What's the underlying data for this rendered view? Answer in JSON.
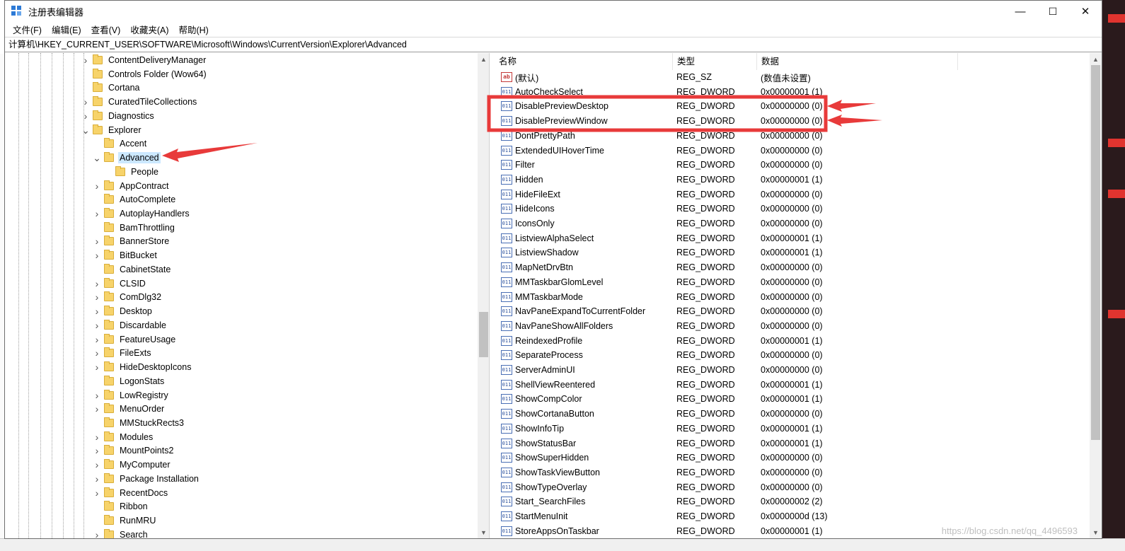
{
  "window": {
    "title": "注册表编辑器",
    "controls": {
      "minimize": "—",
      "maximize": "☐",
      "close": "✕"
    }
  },
  "menu": [
    "文件(F)",
    "编辑(E)",
    "查看(V)",
    "收藏夹(A)",
    "帮助(H)"
  ],
  "address": "计算机\\HKEY_CURRENT_USER\\SOFTWARE\\Microsoft\\Windows\\CurrentVersion\\Explorer\\Advanced",
  "tree": {
    "items": [
      {
        "label": "ContentDeliveryManager",
        "level": 1,
        "expander": "collapsed"
      },
      {
        "label": "Controls Folder (Wow64)",
        "level": 1,
        "expander": "none"
      },
      {
        "label": "Cortana",
        "level": 1,
        "expander": "none"
      },
      {
        "label": "CuratedTileCollections",
        "level": 1,
        "expander": "collapsed"
      },
      {
        "label": "Diagnostics",
        "level": 1,
        "expander": "collapsed"
      },
      {
        "label": "Explorer",
        "level": 1,
        "expander": "expanded"
      },
      {
        "label": "Accent",
        "level": 2,
        "expander": "none"
      },
      {
        "label": "Advanced",
        "level": 2,
        "expander": "expanded",
        "selected": true
      },
      {
        "label": "People",
        "level": 3,
        "expander": "none"
      },
      {
        "label": "AppContract",
        "level": 2,
        "expander": "collapsed"
      },
      {
        "label": "AutoComplete",
        "level": 2,
        "expander": "none"
      },
      {
        "label": "AutoplayHandlers",
        "level": 2,
        "expander": "collapsed"
      },
      {
        "label": "BamThrottling",
        "level": 2,
        "expander": "none"
      },
      {
        "label": "BannerStore",
        "level": 2,
        "expander": "collapsed"
      },
      {
        "label": "BitBucket",
        "level": 2,
        "expander": "collapsed"
      },
      {
        "label": "CabinetState",
        "level": 2,
        "expander": "none"
      },
      {
        "label": "CLSID",
        "level": 2,
        "expander": "collapsed"
      },
      {
        "label": "ComDlg32",
        "level": 2,
        "expander": "collapsed"
      },
      {
        "label": "Desktop",
        "level": 2,
        "expander": "collapsed"
      },
      {
        "label": "Discardable",
        "level": 2,
        "expander": "collapsed"
      },
      {
        "label": "FeatureUsage",
        "level": 2,
        "expander": "collapsed"
      },
      {
        "label": "FileExts",
        "level": 2,
        "expander": "collapsed"
      },
      {
        "label": "HideDesktopIcons",
        "level": 2,
        "expander": "collapsed"
      },
      {
        "label": "LogonStats",
        "level": 2,
        "expander": "none"
      },
      {
        "label": "LowRegistry",
        "level": 2,
        "expander": "collapsed"
      },
      {
        "label": "MenuOrder",
        "level": 2,
        "expander": "collapsed"
      },
      {
        "label": "MMStuckRects3",
        "level": 2,
        "expander": "none"
      },
      {
        "label": "Modules",
        "level": 2,
        "expander": "collapsed"
      },
      {
        "label": "MountPoints2",
        "level": 2,
        "expander": "collapsed"
      },
      {
        "label": "MyComputer",
        "level": 2,
        "expander": "collapsed"
      },
      {
        "label": "Package Installation",
        "level": 2,
        "expander": "collapsed"
      },
      {
        "label": "RecentDocs",
        "level": 2,
        "expander": "collapsed"
      },
      {
        "label": "Ribbon",
        "level": 2,
        "expander": "none"
      },
      {
        "label": "RunMRU",
        "level": 2,
        "expander": "none"
      },
      {
        "label": "Search",
        "level": 2,
        "expander": "collapsed"
      }
    ]
  },
  "list": {
    "columns": [
      "名称",
      "类型",
      "数据"
    ],
    "rows": [
      {
        "name": "(默认)",
        "type": "REG_SZ",
        "data": "(数值未设置)",
        "icon": "string"
      },
      {
        "name": "AutoCheckSelect",
        "type": "REG_DWORD",
        "data": "0x00000001 (1)",
        "icon": "binary"
      },
      {
        "name": "DisablePreviewDesktop",
        "type": "REG_DWORD",
        "data": "0x00000000 (0)",
        "icon": "binary"
      },
      {
        "name": "DisablePreviewWindow",
        "type": "REG_DWORD",
        "data": "0x00000000 (0)",
        "icon": "binary"
      },
      {
        "name": "DontPrettyPath",
        "type": "REG_DWORD",
        "data": "0x00000000 (0)",
        "icon": "binary"
      },
      {
        "name": "ExtendedUIHoverTime",
        "type": "REG_DWORD",
        "data": "0x00000000 (0)",
        "icon": "binary"
      },
      {
        "name": "Filter",
        "type": "REG_DWORD",
        "data": "0x00000000 (0)",
        "icon": "binary"
      },
      {
        "name": "Hidden",
        "type": "REG_DWORD",
        "data": "0x00000001 (1)",
        "icon": "binary"
      },
      {
        "name": "HideFileExt",
        "type": "REG_DWORD",
        "data": "0x00000000 (0)",
        "icon": "binary"
      },
      {
        "name": "HideIcons",
        "type": "REG_DWORD",
        "data": "0x00000000 (0)",
        "icon": "binary"
      },
      {
        "name": "IconsOnly",
        "type": "REG_DWORD",
        "data": "0x00000000 (0)",
        "icon": "binary"
      },
      {
        "name": "ListviewAlphaSelect",
        "type": "REG_DWORD",
        "data": "0x00000001 (1)",
        "icon": "binary"
      },
      {
        "name": "ListviewShadow",
        "type": "REG_DWORD",
        "data": "0x00000001 (1)",
        "icon": "binary"
      },
      {
        "name": "MapNetDrvBtn",
        "type": "REG_DWORD",
        "data": "0x00000000 (0)",
        "icon": "binary"
      },
      {
        "name": "MMTaskbarGlomLevel",
        "type": "REG_DWORD",
        "data": "0x00000000 (0)",
        "icon": "binary"
      },
      {
        "name": "MMTaskbarMode",
        "type": "REG_DWORD",
        "data": "0x00000000 (0)",
        "icon": "binary"
      },
      {
        "name": "NavPaneExpandToCurrentFolder",
        "type": "REG_DWORD",
        "data": "0x00000000 (0)",
        "icon": "binary"
      },
      {
        "name": "NavPaneShowAllFolders",
        "type": "REG_DWORD",
        "data": "0x00000000 (0)",
        "icon": "binary"
      },
      {
        "name": "ReindexedProfile",
        "type": "REG_DWORD",
        "data": "0x00000001 (1)",
        "icon": "binary"
      },
      {
        "name": "SeparateProcess",
        "type": "REG_DWORD",
        "data": "0x00000000 (0)",
        "icon": "binary"
      },
      {
        "name": "ServerAdminUI",
        "type": "REG_DWORD",
        "data": "0x00000000 (0)",
        "icon": "binary"
      },
      {
        "name": "ShellViewReentered",
        "type": "REG_DWORD",
        "data": "0x00000001 (1)",
        "icon": "binary"
      },
      {
        "name": "ShowCompColor",
        "type": "REG_DWORD",
        "data": "0x00000001 (1)",
        "icon": "binary"
      },
      {
        "name": "ShowCortanaButton",
        "type": "REG_DWORD",
        "data": "0x00000000 (0)",
        "icon": "binary"
      },
      {
        "name": "ShowInfoTip",
        "type": "REG_DWORD",
        "data": "0x00000001 (1)",
        "icon": "binary"
      },
      {
        "name": "ShowStatusBar",
        "type": "REG_DWORD",
        "data": "0x00000001 (1)",
        "icon": "binary"
      },
      {
        "name": "ShowSuperHidden",
        "type": "REG_DWORD",
        "data": "0x00000000 (0)",
        "icon": "binary"
      },
      {
        "name": "ShowTaskViewButton",
        "type": "REG_DWORD",
        "data": "0x00000000 (0)",
        "icon": "binary"
      },
      {
        "name": "ShowTypeOverlay",
        "type": "REG_DWORD",
        "data": "0x00000000 (0)",
        "icon": "binary"
      },
      {
        "name": "Start_SearchFiles",
        "type": "REG_DWORD",
        "data": "0x00000002 (2)",
        "icon": "binary"
      },
      {
        "name": "StartMenuInit",
        "type": "REG_DWORD",
        "data": "0x0000000d (13)",
        "icon": "binary"
      },
      {
        "name": "StoreAppsOnTaskbar",
        "type": "REG_DWORD",
        "data": "0x00000001 (1)",
        "icon": "binary"
      }
    ]
  },
  "icons": {
    "string_value": "ab",
    "binary_value": "011"
  },
  "watermark": "https://blog.csdn.net/qq_4496593",
  "colors": {
    "selection": "#cce8ff",
    "annotation": "#e83a3a",
    "folder": "#f7d36a"
  }
}
